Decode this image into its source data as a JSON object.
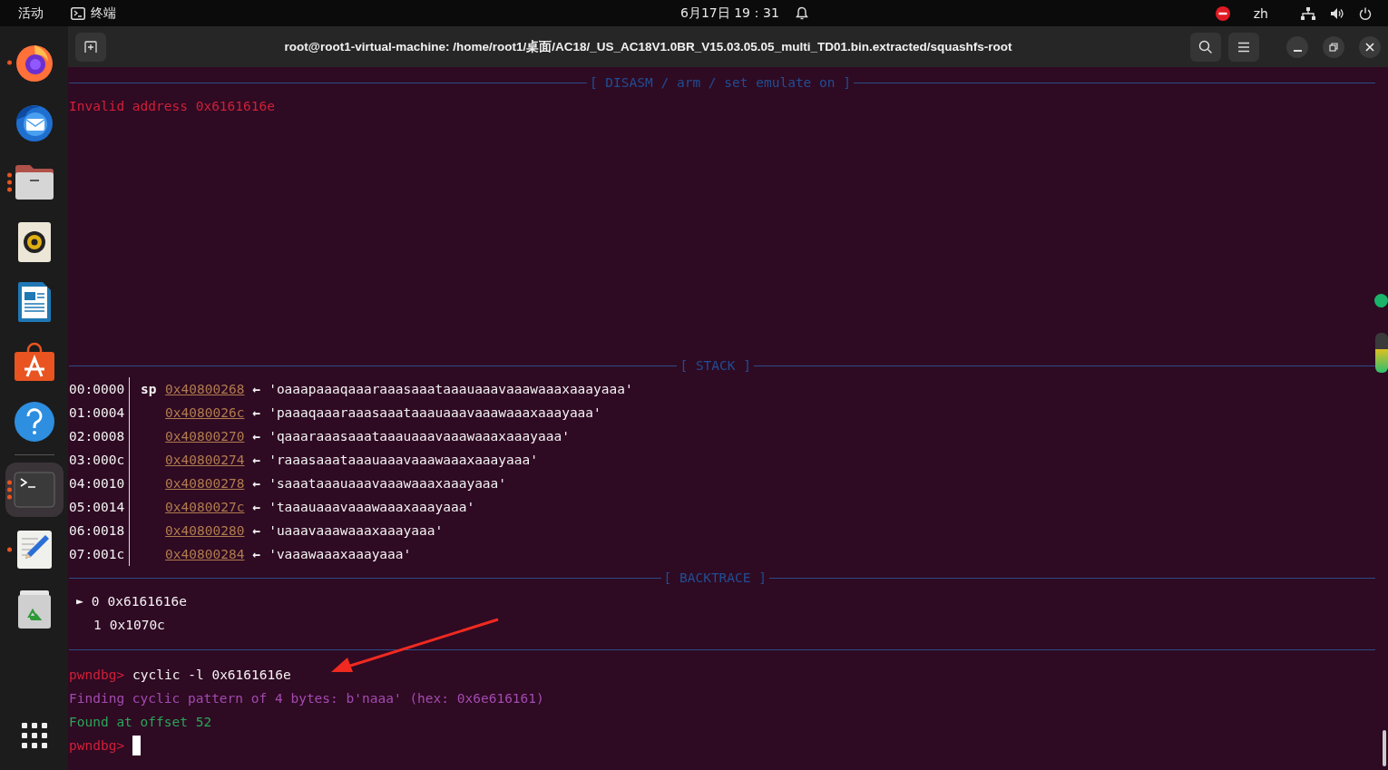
{
  "top_bar": {
    "activities": "活动",
    "app_name": "终端",
    "clock": "6月17日 19：31",
    "input_method": "zh"
  },
  "dock": {
    "apps": [
      {
        "kind": "browser",
        "running": true,
        "many_windows": false,
        "selected": false
      },
      {
        "kind": "mail",
        "running": false,
        "selected": false
      },
      {
        "kind": "files",
        "running": true,
        "many_windows": true,
        "selected": false
      },
      {
        "kind": "music",
        "running": false,
        "selected": false
      },
      {
        "kind": "writer",
        "running": false,
        "selected": false
      },
      {
        "kind": "store",
        "running": false,
        "selected": false
      },
      {
        "kind": "help",
        "running": false,
        "selected": false
      },
      {
        "kind": "terminal",
        "running": true,
        "many_windows": true,
        "selected": true
      },
      {
        "kind": "editor",
        "running": true,
        "many_windows": false,
        "selected": false
      },
      {
        "kind": "trash",
        "running": false,
        "selected": false
      }
    ]
  },
  "window": {
    "title": "root@root1-virtual-machine: /home/root1/桌面/AC18/_US_AC18V1.0BR_V15.03.05.05_multi_TD01.bin.extracted/squashfs-root"
  },
  "terminal": {
    "disasm": {
      "header": "[ DISASM / arm / set emulate on ]",
      "message": "Invalid address 0x6161616e"
    },
    "stack": {
      "header": "[ STACK ]",
      "rows": [
        {
          "offset": "00:0000",
          "register": "sp",
          "address": "0x40800268",
          "arrow": "←",
          "value": "'oaaapaaaqaaaraaasaaataaauaaavaaawaaaxaaayaaa'"
        },
        {
          "offset": "01:0004",
          "address": "0x4080026c",
          "arrow": "←",
          "value": "'paaaqaaaraaasaaataaauaaavaaawaaaxaaayaaa'"
        },
        {
          "offset": "02:0008",
          "address": "0x40800270",
          "arrow": "←",
          "value": "'qaaaraaasaaataaauaaavaaawaaaxaaayaaa'"
        },
        {
          "offset": "03:000c",
          "address": "0x40800274",
          "arrow": "←",
          "value": "'raaasaaataaauaaavaaawaaaxaaayaaa'"
        },
        {
          "offset": "04:0010",
          "address": "0x40800278",
          "arrow": "←",
          "value": "'saaataaauaaavaaawaaaxaaayaaa'"
        },
        {
          "offset": "05:0014",
          "address": "0x4080027c",
          "arrow": "←",
          "value": "'taaauaaavaaawaaaxaaayaaa'"
        },
        {
          "offset": "06:0018",
          "address": "0x40800280",
          "arrow": "←",
          "value": "'uaaavaaawaaaxaaayaaa'"
        },
        {
          "offset": "07:001c",
          "address": "0x40800284",
          "arrow": "←",
          "value": "'vaaawaaaxaaayaaa'"
        }
      ]
    },
    "backtrace": {
      "header": "[ BACKTRACE ]",
      "frames": [
        {
          "marker": "►",
          "index": "0",
          "address": "0x6161616e",
          "selected": true
        },
        {
          "index": "1",
          "address": "0x1070c",
          "selected": false
        }
      ]
    },
    "session": [
      {
        "kind": "command",
        "prompt": "pwndbg>",
        "text": "cyclic -l 0x6161616e"
      },
      {
        "kind": "info",
        "text": "Finding cyclic pattern of 4 bytes: b'naaa' (hex: 0x6e616161)"
      },
      {
        "kind": "success",
        "text": "Found at offset 52"
      },
      {
        "kind": "input",
        "prompt": "pwndbg>"
      }
    ]
  }
}
